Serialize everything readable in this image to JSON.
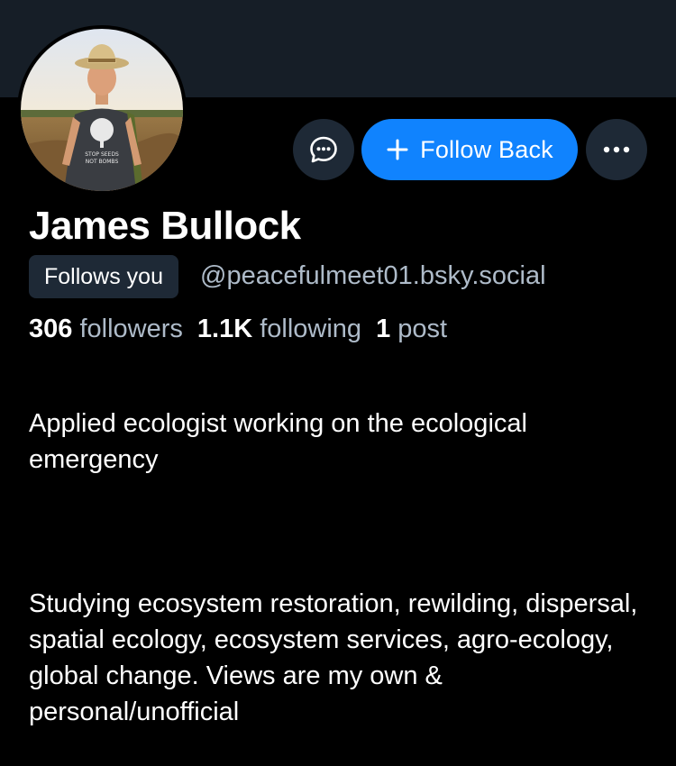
{
  "profile": {
    "display_name": "James Bullock",
    "handle": "@peacefulmeet01.bsky.social",
    "follows_you_label": "Follows you",
    "avatar_shirt_text": "STOP SEEDS\nNOT BOMBS",
    "stats": {
      "followers_count": "306",
      "followers_label": "followers",
      "following_count": "1.1K",
      "following_label": "following",
      "posts_count": "1",
      "posts_label": "post"
    },
    "bio_line1": "Applied ecologist working on the ecological emergency",
    "bio_line2": "Studying ecosystem restoration, rewilding, dispersal, spatial ecology, ecosystem services, agro-ecology, global change. Views are my own & personal/unofficial"
  },
  "actions": {
    "message_icon": "chat-bubble-icon",
    "follow_back_icon": "plus-icon",
    "follow_back_label": "Follow Back",
    "more_icon": "ellipsis-icon"
  },
  "colors": {
    "background": "#000000",
    "banner": "#161e27",
    "accent": "#1083fe",
    "muted_text": "#aebbc9",
    "chip_background": "#1e2936"
  }
}
